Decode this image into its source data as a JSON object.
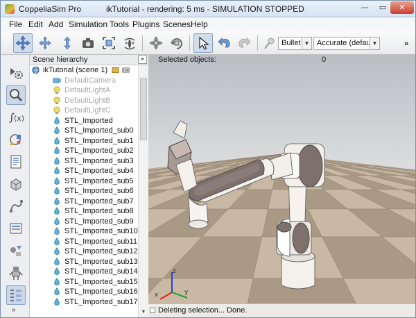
{
  "window": {
    "app_name": "CoppeliaSim Pro",
    "title": "ikTutorial - rendering: 5 ms - SIMULATION STOPPED",
    "min_glyph": "—",
    "max_glyph": "▭",
    "close_glyph": "✕"
  },
  "menu": [
    "File",
    "Edit",
    "Add",
    "Simulation",
    "Tools",
    "Plugins",
    "Scenes",
    "Help"
  ],
  "toolbar": {
    "engine": "Bullet",
    "accuracy": "Accurate (default)",
    "dropdown_arrow": "▼",
    "overflow": "»",
    "pressed_tool": "click-select-icon",
    "icons": [
      "camera-pan-icon",
      "camera-rotate-icon",
      "camera-shift-icon",
      "camera-angle-icon",
      "fit-to-view-icon",
      "manipulation-icon",
      "object-shift-icon",
      "object-rotate-icon",
      "click-select-icon",
      "undo-icon",
      "redo-icon",
      "dynamics-icon"
    ]
  },
  "sidebar_icons": [
    "simulation-settings-icon",
    "selection-icon",
    "scripts-icon",
    "shapes-icon",
    "calculation-modules-icon",
    "collections-icon",
    "paths-icon",
    "user-settings-icon",
    "layers-icon",
    "robot-icon",
    "model-browser-icon"
  ],
  "hierarchy": {
    "title": "Scene hierarchy",
    "close_glyph": "×",
    "scene_label": "ikTutorial (scene 1)",
    "scroll_glyph": "▼",
    "items": [
      {
        "label": "DefaultCamera",
        "icon": "camera-icon",
        "dim": true
      },
      {
        "label": "DefaultLightA",
        "icon": "light-icon",
        "dim": true
      },
      {
        "label": "DefaultLightB",
        "icon": "light-icon",
        "dim": true
      },
      {
        "label": "DefaultLightC",
        "icon": "light-icon",
        "dim": true
      },
      {
        "label": "STL_Imported",
        "icon": "shape-icon",
        "dim": false
      },
      {
        "label": "STL_Imported_sub0",
        "icon": "shape-icon",
        "dim": false
      },
      {
        "label": "STL_Imported_sub1",
        "icon": "shape-icon",
        "dim": false
      },
      {
        "label": "STL_Imported_sub2",
        "icon": "shape-icon",
        "dim": false
      },
      {
        "label": "STL_Imported_sub3",
        "icon": "shape-icon",
        "dim": false
      },
      {
        "label": "STL_Imported_sub4",
        "icon": "shape-icon",
        "dim": false
      },
      {
        "label": "STL_Imported_sub5",
        "icon": "shape-icon",
        "dim": false
      },
      {
        "label": "STL_Imported_sub6",
        "icon": "shape-icon",
        "dim": false
      },
      {
        "label": "STL_Imported_sub7",
        "icon": "shape-icon",
        "dim": false
      },
      {
        "label": "STL_Imported_sub8",
        "icon": "shape-icon",
        "dim": false
      },
      {
        "label": "STL_Imported_sub9",
        "icon": "shape-icon",
        "dim": false
      },
      {
        "label": "STL_Imported_sub10",
        "icon": "shape-icon",
        "dim": false
      },
      {
        "label": "STL_Imported_sub11",
        "icon": "shape-icon",
        "dim": false
      },
      {
        "label": "STL_Imported_sub12",
        "icon": "shape-icon",
        "dim": false
      },
      {
        "label": "STL_Imported_sub13",
        "icon": "shape-icon",
        "dim": false
      },
      {
        "label": "STL_Imported_sub14",
        "icon": "shape-icon",
        "dim": false
      },
      {
        "label": "STL_Imported_sub15",
        "icon": "shape-icon",
        "dim": false
      },
      {
        "label": "STL_Imported_sub16",
        "icon": "shape-icon",
        "dim": false
      },
      {
        "label": "STL_Imported_sub17",
        "icon": "shape-icon",
        "dim": false
      }
    ]
  },
  "viewport": {
    "selected_label": "Selected objects:",
    "selected_count": "0",
    "status": "Deleting selection... Done.",
    "axes": [
      "x",
      "y",
      "z"
    ],
    "colors": {
      "x": "#e02020",
      "y": "#20a020",
      "z": "#2040e0",
      "floor_a": "#c9b9a4",
      "floor_b": "#a99985",
      "robot_body": "#f3f0ec",
      "robot_joint": "#7d6e69"
    }
  },
  "colors": {
    "selection": "#cfdcec",
    "dim_text": "#a8a8a8"
  }
}
